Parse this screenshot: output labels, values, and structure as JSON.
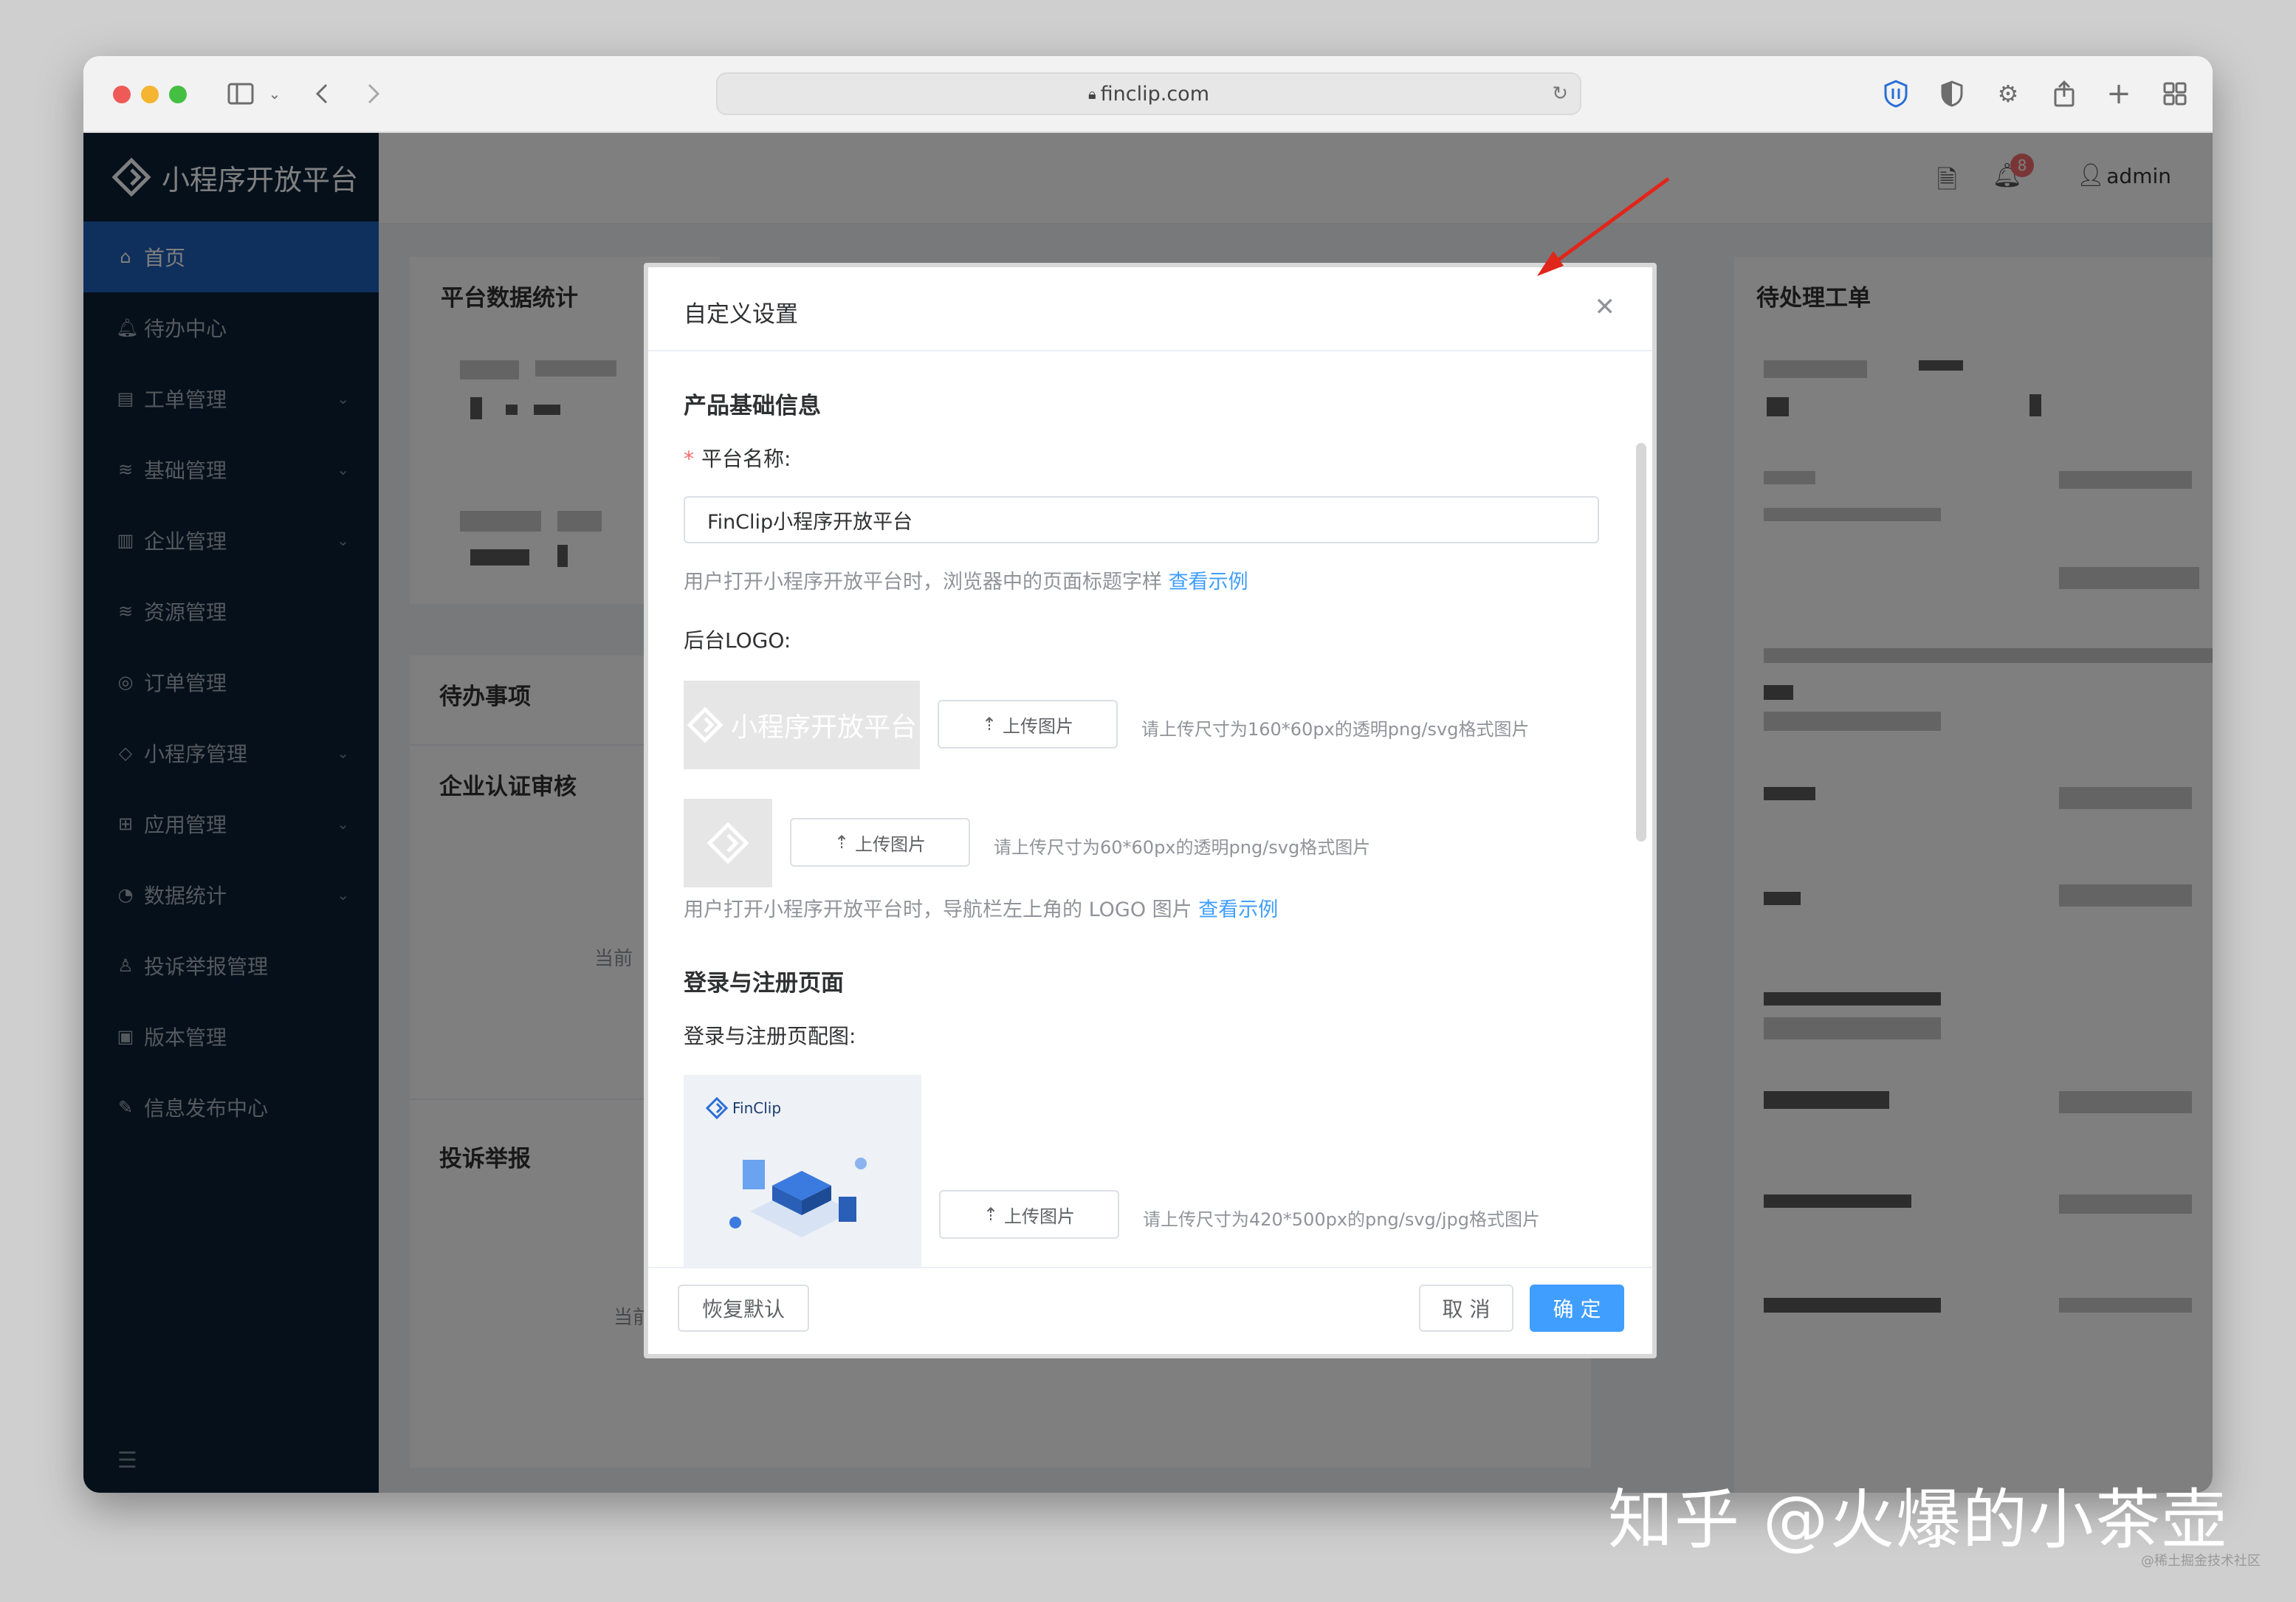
{
  "browser": {
    "url": "finclip.com"
  },
  "app": {
    "title": "小程序开放平台",
    "user": "admin",
    "notification_count": "8"
  },
  "sidebar": {
    "items": [
      {
        "label": "首页",
        "icon": "home-icon"
      },
      {
        "label": "待办中心",
        "icon": "bell-icon"
      },
      {
        "label": "工单管理",
        "icon": "ticket-icon"
      },
      {
        "label": "基础管理",
        "icon": "layers-icon"
      },
      {
        "label": "企业管理",
        "icon": "building-icon"
      },
      {
        "label": "资源管理",
        "icon": "stack-icon"
      },
      {
        "label": "订单管理",
        "icon": "order-icon"
      },
      {
        "label": "小程序管理",
        "icon": "diamond-icon"
      },
      {
        "label": "应用管理",
        "icon": "grid-icon"
      },
      {
        "label": "数据统计",
        "icon": "pie-icon"
      },
      {
        "label": "投诉举报管理",
        "icon": "report-icon"
      },
      {
        "label": "版本管理",
        "icon": "version-icon"
      },
      {
        "label": "信息发布中心",
        "icon": "publish-icon"
      }
    ]
  },
  "dashboard": {
    "stats_title": "平台数据统计",
    "todo_title": "待办事项",
    "cert_title": "企业认证审核",
    "complaint_title": "投诉举报",
    "pending_title": "待处理工单",
    "empty_prefix": "当前"
  },
  "modal": {
    "title": "自定义设置",
    "section_basic": "产品基础信息",
    "platform_name_label": "平台名称:",
    "platform_name_value": "FinClip小程序开放平台",
    "platform_name_hint": "用户打开小程序开放平台时，浏览器中的页面标题字样",
    "view_example": "查看示例",
    "logo_label": "后台LOGO:",
    "logo_preview_text": "小程序开放平台",
    "upload_label": "上传图片",
    "logo_hint_1": "请上传尺寸为160*60px的透明png/svg格式图片",
    "logo_hint_2": "请上传尺寸为60*60px的透明png/svg格式图片",
    "logo_desc": "用户打开小程序开放平台时，导航栏左上角的 LOGO 图片",
    "section_login": "登录与注册页面",
    "login_img_label": "登录与注册页配图:",
    "login_brand": "FinClip",
    "login_img_hint": "请上传尺寸为420*500px的png/svg/jpg格式图片",
    "reset_button": "恢复默认",
    "cancel_button": "取 消",
    "confirm_button": "确 定"
  },
  "watermark": {
    "text": "知乎 @火爆的小茶壶",
    "small": "@稀土掘金技术社区"
  },
  "colors": {
    "sidebar_bg": "#0b2136",
    "active_blue": "#1f5eb8",
    "primary": "#409eff",
    "arrow_red": "#e0261b"
  }
}
